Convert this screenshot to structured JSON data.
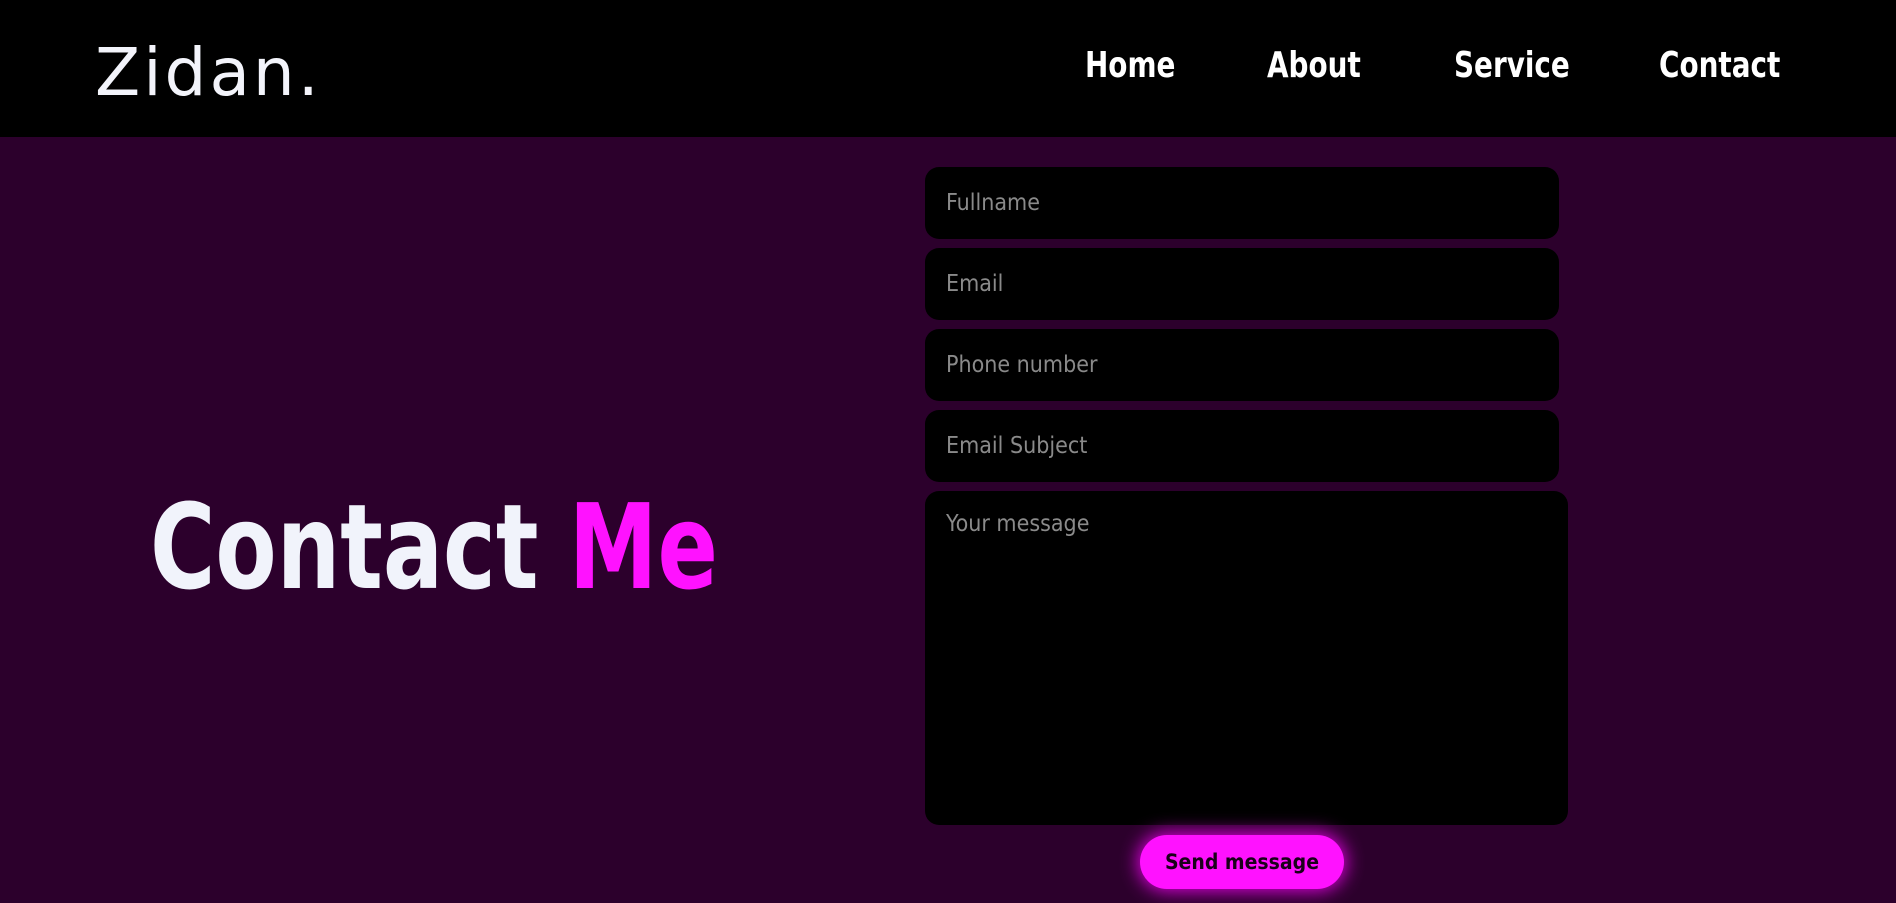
{
  "header": {
    "logo": "Zidan.",
    "nav": [
      {
        "label": "Home"
      },
      {
        "label": "About"
      },
      {
        "label": "Service"
      },
      {
        "label": "Contact"
      }
    ]
  },
  "hero": {
    "title_part1": "Contact",
    "title_part2": "Me"
  },
  "form": {
    "fullname_placeholder": "Fullname",
    "email_placeholder": "Email",
    "phone_placeholder": "Phone number",
    "subject_placeholder": "Email Subject",
    "message_placeholder": "Your message",
    "submit_label": "Send message"
  },
  "colors": {
    "background": "#2c002c",
    "header_background": "#000000",
    "accent": "#ff12ff",
    "field_background": "#000000"
  }
}
